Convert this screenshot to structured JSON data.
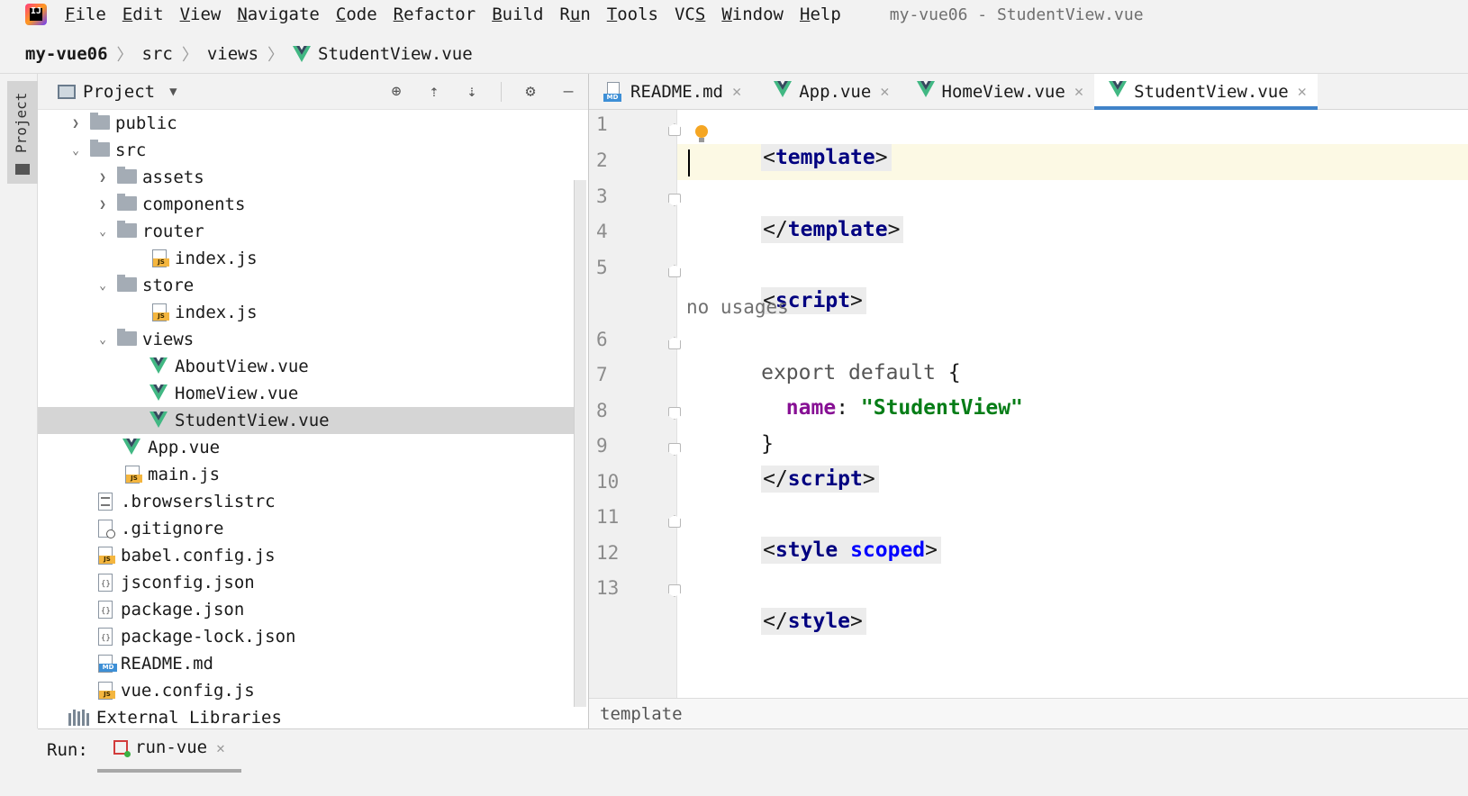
{
  "menu": {
    "items": [
      {
        "mnemonic": "F",
        "rest": "ile"
      },
      {
        "mnemonic": "E",
        "rest": "dit"
      },
      {
        "mnemonic": "V",
        "rest": "iew"
      },
      {
        "mnemonic": "N",
        "rest": "avigate"
      },
      {
        "mnemonic": "C",
        "rest": "ode"
      },
      {
        "mnemonic": "R",
        "rest": "efactor"
      },
      {
        "mnemonic": "B",
        "rest": "uild"
      },
      {
        "pre": "R",
        "mnemonic": "u",
        "rest": "n"
      },
      {
        "mnemonic": "T",
        "rest": "ools"
      },
      {
        "pre": "VC",
        "mnemonic": "S",
        "rest": ""
      },
      {
        "mnemonic": "W",
        "rest": "indow"
      },
      {
        "mnemonic": "H",
        "rest": "elp"
      }
    ],
    "window_title": "my-vue06 - StudentView.vue"
  },
  "breadcrumb": [
    "my-vue06",
    "src",
    "views",
    "StudentView.vue"
  ],
  "left_stripe": {
    "project_tab": "Project"
  },
  "project_panel": {
    "title": "Project",
    "tree": [
      {
        "label": "public",
        "type": "folder",
        "expanded": false
      },
      {
        "label": "src",
        "type": "folder",
        "expanded": true
      },
      {
        "label": "assets",
        "type": "folder",
        "expanded": false
      },
      {
        "label": "components",
        "type": "folder",
        "expanded": false
      },
      {
        "label": "router",
        "type": "folder",
        "expanded": true
      },
      {
        "label": "index.js",
        "type": "js"
      },
      {
        "label": "store",
        "type": "folder",
        "expanded": true
      },
      {
        "label": "index.js",
        "type": "js"
      },
      {
        "label": "views",
        "type": "folder",
        "expanded": true
      },
      {
        "label": "AboutView.vue",
        "type": "vue"
      },
      {
        "label": "HomeView.vue",
        "type": "vue"
      },
      {
        "label": "StudentView.vue",
        "type": "vue",
        "selected": true
      },
      {
        "label": "App.vue",
        "type": "vue"
      },
      {
        "label": "main.js",
        "type": "js"
      },
      {
        "label": ".browserslistrc",
        "type": "text"
      },
      {
        "label": ".gitignore",
        "type": "ignore"
      },
      {
        "label": "babel.config.js",
        "type": "js"
      },
      {
        "label": "jsconfig.json",
        "type": "json"
      },
      {
        "label": "package.json",
        "type": "json"
      },
      {
        "label": "package-lock.json",
        "type": "json"
      },
      {
        "label": "README.md",
        "type": "md"
      },
      {
        "label": "vue.config.js",
        "type": "js"
      },
      {
        "label": "External Libraries",
        "type": "libraries"
      }
    ]
  },
  "editor": {
    "tabs": [
      {
        "label": "README.md",
        "type": "md",
        "active": false
      },
      {
        "label": "App.vue",
        "type": "vue",
        "active": false
      },
      {
        "label": "HomeView.vue",
        "type": "vue",
        "active": false
      },
      {
        "label": "StudentView.vue",
        "type": "vue",
        "active": true
      }
    ],
    "line_numbers": [
      "1",
      "2",
      "3",
      "4",
      "5",
      "6",
      "7",
      "8",
      "9",
      "10",
      "11",
      "12",
      "13"
    ],
    "code": {
      "l1_open": "<",
      "l1_tag": "template",
      "l1_close": ">",
      "l3_open": "</",
      "l3_tag": "template",
      "l3_close": ">",
      "l5_open": "<",
      "l5_tag": "script",
      "l5_close": ">",
      "usage_hint": "no usages",
      "l6_kw": "export default",
      "l6_brace": " {",
      "l7_indent": "  ",
      "l7_prop": "name",
      "l7_colon": ": ",
      "l7_str": "\"StudentView\"",
      "l8_brace": "}",
      "l9_open": "</",
      "l9_tag": "script",
      "l9_close": ">",
      "l11_open": "<",
      "l11_tag": "style",
      "l11_space": " ",
      "l11_attr": "scoped",
      "l11_close": ">",
      "l13_open": "</",
      "l13_tag": "style",
      "l13_close": ">"
    },
    "status_breadcrumb": "template"
  },
  "run_bar": {
    "label": "Run:",
    "tab": "run-vue"
  },
  "colors": {
    "vue_green": "#41b883",
    "vue_dark": "#35495e",
    "active_tab_underline": "#4083c9",
    "selected_row": "#d5d5d5",
    "current_line": "#fcf9e4"
  }
}
